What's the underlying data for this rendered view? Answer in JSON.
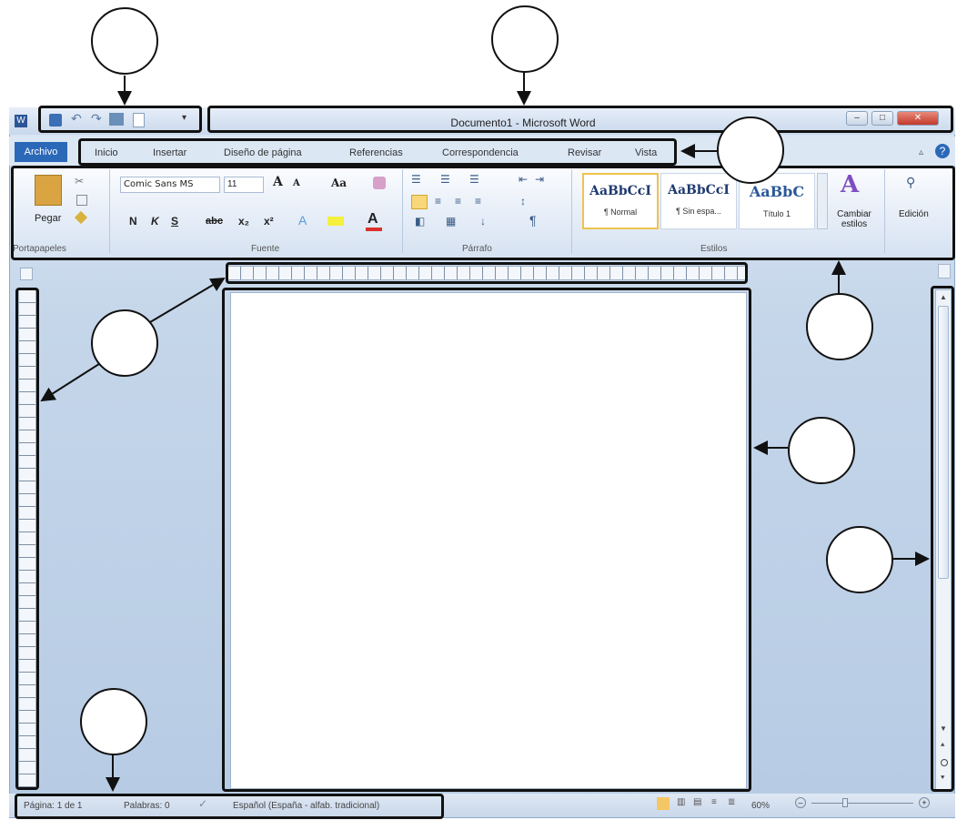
{
  "window": {
    "title": "Documento1 - Microsoft Word",
    "controls": [
      "minimize-icon",
      "maximize-icon",
      "close-icon"
    ]
  },
  "qat": {
    "icons": [
      "word-icon",
      "save-icon",
      "undo-icon",
      "redo-icon",
      "print-preview-icon",
      "new-icon",
      "customize-icon"
    ]
  },
  "tabs": {
    "file": "Archivo",
    "items": [
      "Inicio",
      "Insertar",
      "Diseño de página",
      "Referencias",
      "Correspondencia",
      "Revisar",
      "Vista"
    ]
  },
  "ribbon": {
    "clipboard": {
      "paste": "Pegar",
      "label": "Portapapeles"
    },
    "font": {
      "name": "Comic Sans MS",
      "size": "11",
      "case_button": "Aa",
      "bold": "N",
      "italic": "K",
      "underline": "S",
      "strike": "abc",
      "label": "Fuente"
    },
    "paragraph": {
      "label": "Párrafo",
      "pilcrow": "¶"
    },
    "styles": {
      "cards": [
        {
          "preview": "AaBbCcI",
          "name": "¶ Normal"
        },
        {
          "preview": "AaBbCcI",
          "name": "¶ Sin espa..."
        },
        {
          "preview": "AaBbC",
          "name": "Título 1"
        }
      ],
      "change_styles": "Cambiar estilos",
      "label": "Estilos"
    },
    "editing": {
      "label": "Edición"
    }
  },
  "statusbar": {
    "page": "Página: 1 de 1",
    "words": "Palabras: 0",
    "language": "Español (España - alfab. tradicional)",
    "zoom": "60%"
  }
}
